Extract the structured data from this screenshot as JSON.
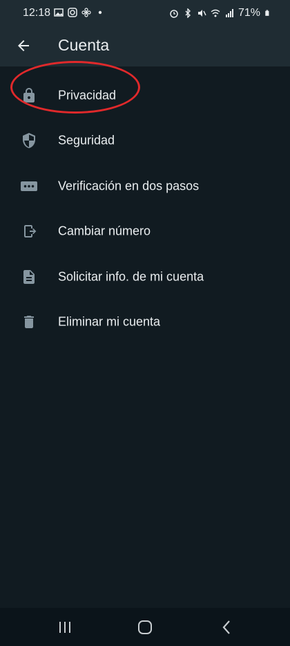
{
  "status_bar": {
    "time": "12:18",
    "battery": "71%"
  },
  "header": {
    "title": "Cuenta"
  },
  "menu": {
    "items": [
      {
        "label": "Privacidad",
        "icon": "lock-icon"
      },
      {
        "label": "Seguridad",
        "icon": "shield-icon"
      },
      {
        "label": "Verificación en dos pasos",
        "icon": "dots-icon"
      },
      {
        "label": "Cambiar número",
        "icon": "phone-change-icon"
      },
      {
        "label": "Solicitar info. de mi cuenta",
        "icon": "document-icon"
      },
      {
        "label": "Eliminar mi cuenta",
        "icon": "trash-icon"
      }
    ]
  },
  "colors": {
    "background": "#111b21",
    "header": "#1f2c33",
    "icon": "#8696a0",
    "text": "#e9edef",
    "annotation": "#e0292b"
  }
}
